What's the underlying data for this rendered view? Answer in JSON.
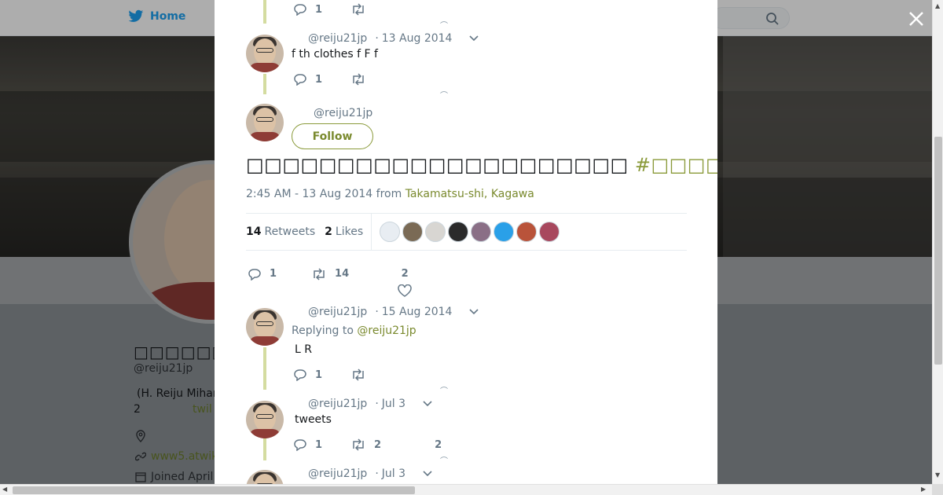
{
  "background": {
    "nav_home": "Home",
    "profile_name": "□□□□□□□□□",
    "handle": "@reiju21jp",
    "bio_line1": "(H. Reiju Mihar",
    "bio_line2_num": "2",
    "bio_line2_link": "twil",
    "link": "www5.atwik",
    "joined": "Joined April"
  },
  "tweets": [
    {
      "reply_count": "1"
    },
    {
      "handle": "@reiju21jp",
      "date": "13 Aug 2014",
      "text": "f  th  clothes f  F  f",
      "reply_count": "1"
    },
    {
      "handle": "@reiju21jp",
      "follow_label": "Follow"
    },
    {
      "handle": "@reiju21jp",
      "date": "15 Aug 2014",
      "replying_label": "Replying to",
      "replying_handle": "@reiju21jp",
      "text": "L  R",
      "reply_count": "1"
    },
    {
      "handle": "@reiju21jp",
      "date": "Jul 3",
      "text": "tweets",
      "reply_count": "1",
      "retweet_count": "2",
      "like_count": "2"
    },
    {
      "handle": "@reiju21jp",
      "date": "Jul 3"
    }
  ],
  "main_tweet": {
    "text_before": "□□□□□□□□□□□□□□□□□□□□□",
    "hashtag": "#□□□□",
    "text_after": "□□□□□□□□□□□□□□□□□□□□□□□",
    "time": "2:45 AM - 13 Aug 2014",
    "from_label": "from",
    "location": "Takamatsu-shi, Kagawa",
    "retweets_count": "14",
    "retweets_label": "Retweets",
    "likes_count": "2",
    "likes_label": "Likes",
    "reply_count": "1",
    "retweet_count": "14",
    "like_count": "2"
  },
  "liker_colors": [
    "#e8edf2",
    "#7a6a55",
    "#d8d6d2",
    "#2b2b2b",
    "#8a6f86",
    "#2aa0e8",
    "#b9533a",
    "#a8485e"
  ],
  "colors": {
    "accent": "#7a8a2e",
    "thread": "#d4dca0"
  }
}
